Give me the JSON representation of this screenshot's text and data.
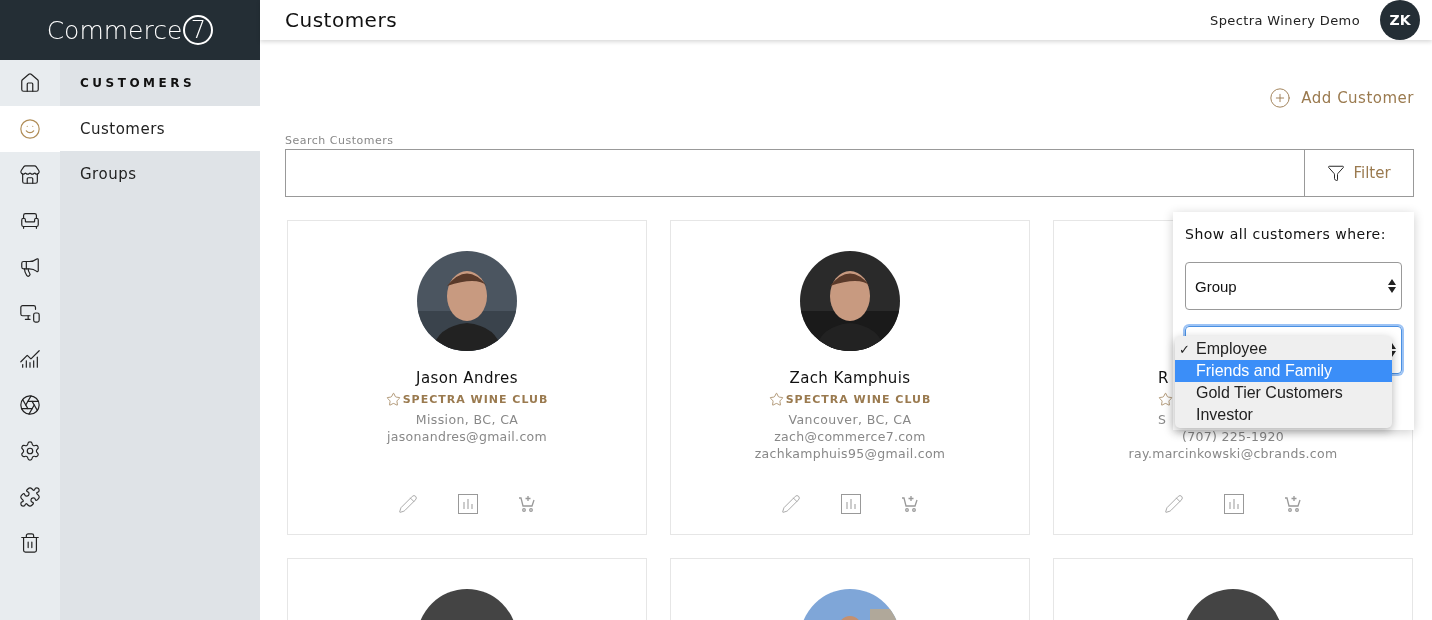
{
  "logo": {
    "text": "Commerce",
    "mark": "7"
  },
  "header": {
    "title": "Customers",
    "account": "Spectra Winery Demo",
    "avatar": "ZK"
  },
  "rail": [
    {
      "selected": false
    },
    {
      "selected": true
    },
    {
      "selected": false
    },
    {
      "selected": false
    },
    {
      "selected": false
    },
    {
      "selected": false
    },
    {
      "selected": false
    },
    {
      "selected": false
    },
    {
      "selected": false
    },
    {
      "selected": false
    },
    {
      "selected": false
    }
  ],
  "subnav": {
    "heading": "CUSTOMERS",
    "items": [
      {
        "label": "Customers",
        "selected": true
      },
      {
        "label": "Groups",
        "selected": false
      }
    ]
  },
  "add_button": "Add Customer",
  "search": {
    "label": "Search Customers",
    "filter_button": "Filter"
  },
  "cards": [
    {
      "name": "Jason Andres",
      "club": "SPECTRA WINE CLUB",
      "location": "Mission, BC, CA",
      "lines": [
        "jasonandres@gmail.com"
      ],
      "covered": false
    },
    {
      "name": "Zach Kamphuis",
      "club": "SPECTRA WINE CLUB",
      "location": "Vancouver, BC, CA",
      "lines": [
        "zach@commerce7.com",
        "zachkamphuis95@gmail.com"
      ],
      "covered": false
    },
    {
      "name": "R",
      "location": "S",
      "lines": [
        "(707) 225-1920",
        "ray.marcinkowski@cbrands.com"
      ],
      "covered": true
    }
  ],
  "more_cards": [
    {
      "kind": "blank"
    },
    {
      "kind": "picture"
    },
    {
      "kind": "blank"
    }
  ],
  "filter_popover": {
    "title": "Show all customers where:",
    "check_glyph": "✓",
    "field_select": "Group",
    "value_select": {
      "focused": true
    },
    "options": [
      {
        "label": "Employee",
        "checked": true,
        "selected": false
      },
      {
        "label": "Friends and Family",
        "checked": false,
        "selected": true
      },
      {
        "label": "Gold Tier Customers",
        "checked": false,
        "selected": false
      },
      {
        "label": "Investor",
        "checked": false,
        "selected": false
      }
    ]
  }
}
